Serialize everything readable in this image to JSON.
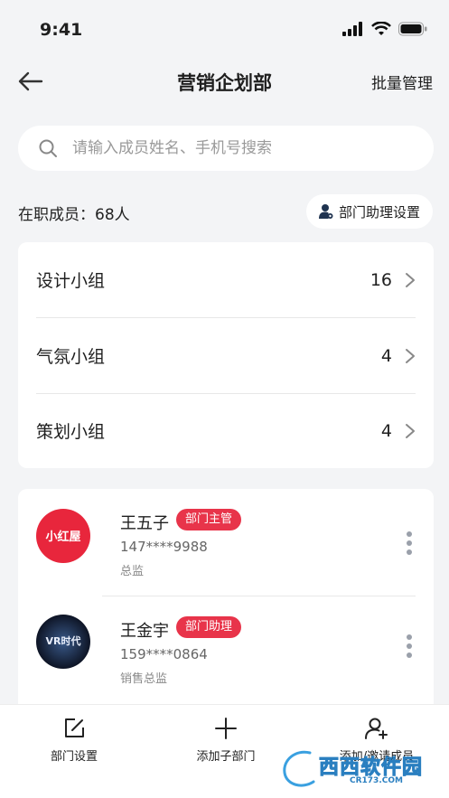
{
  "status_bar": {
    "time": "9:41"
  },
  "nav": {
    "title": "营销企划部",
    "right_action": "批量管理"
  },
  "search": {
    "placeholder": "请输入成员姓名、手机号搜索"
  },
  "summary": {
    "member_count": "在职成员：68人",
    "assistant_settings": "部门助理设置"
  },
  "groups": [
    {
      "name": "设计小组",
      "count": "16"
    },
    {
      "name": "气氛小组",
      "count": "4"
    },
    {
      "name": "策划小组",
      "count": "4"
    }
  ],
  "members": [
    {
      "name": "王五子",
      "badge": "部门主管",
      "phone": "147****9988",
      "title": "总监",
      "avatar_text": "小红屋"
    },
    {
      "name": "王金宇",
      "badge": "部门助理",
      "phone": "159****0864",
      "title": "销售总监",
      "avatar_text": "VR时代"
    }
  ],
  "tabbar": [
    {
      "label": "部门设置",
      "icon": "edit-icon"
    },
    {
      "label": "添加子部门",
      "icon": "plus-icon"
    },
    {
      "label": "添加/邀请成员",
      "icon": "add-user-icon"
    }
  ],
  "watermark": {
    "text": "西西软件园",
    "sub": "CR173.COM"
  },
  "colors": {
    "accent": "#e8344a",
    "background": "#f3f4f6"
  }
}
